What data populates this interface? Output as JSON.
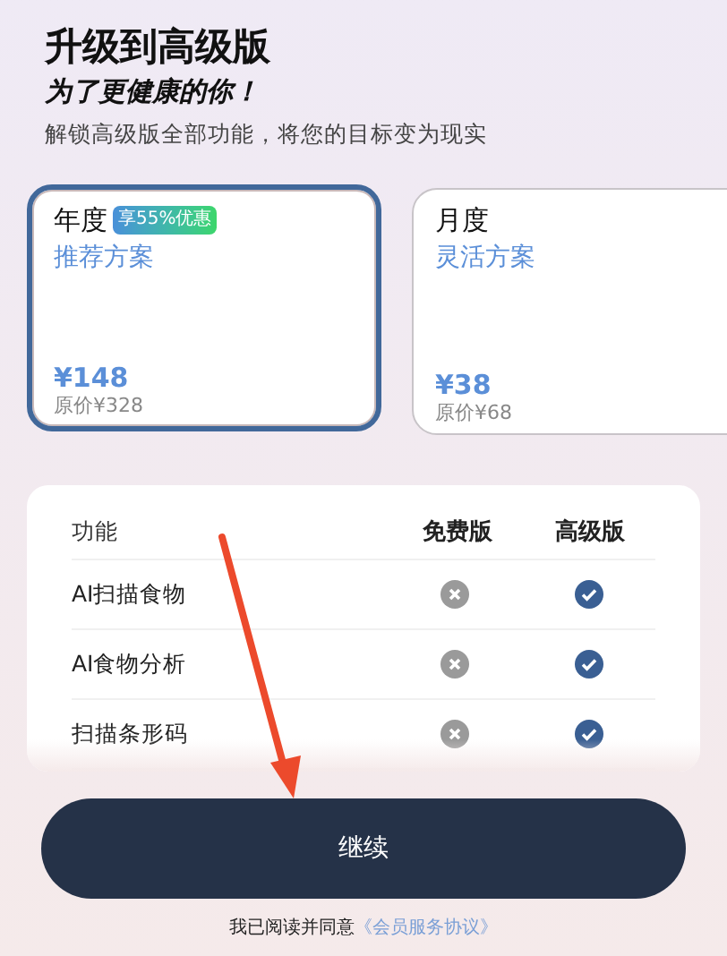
{
  "header": {
    "title": "升级到高级版",
    "subtitle": "为了更健康的你！",
    "description": "解锁高级版全部功能，将您的目标变为现实"
  },
  "plans": [
    {
      "name": "年度",
      "badge": "享55%优惠",
      "tagline": "推荐方案",
      "price": "¥148",
      "original_price": "原价¥328",
      "selected": true
    },
    {
      "name": "月度",
      "tagline": "灵活方案",
      "price": "¥38",
      "original_price": "原价¥68",
      "selected": false
    }
  ],
  "comparison": {
    "columns": [
      "功能",
      "免费版",
      "高级版"
    ],
    "rows": [
      {
        "feature": "AI扫描食物",
        "free": false,
        "premium": true
      },
      {
        "feature": "AI食物分析",
        "free": false,
        "premium": true
      },
      {
        "feature": "扫描条形码",
        "free": false,
        "premium": true
      }
    ]
  },
  "continue_button": "继续",
  "agreement": {
    "text": "我已阅读并同意",
    "link": "《会员服务协议》"
  }
}
